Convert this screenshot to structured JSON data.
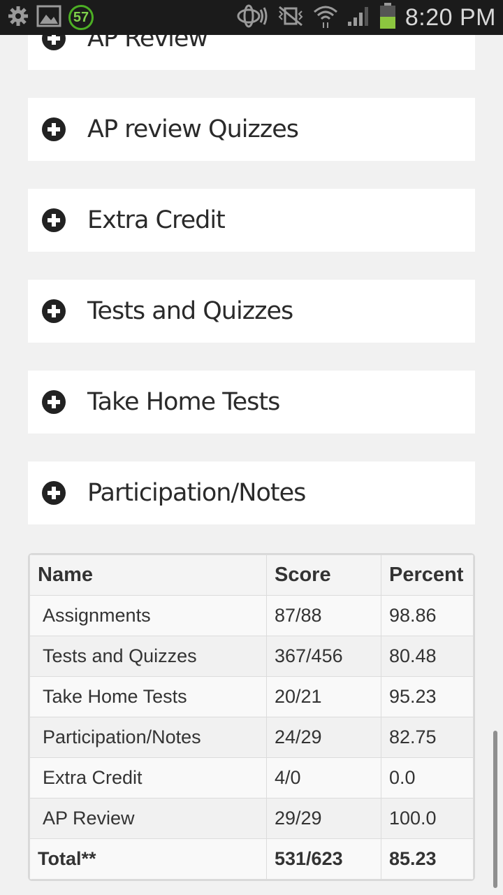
{
  "status_bar": {
    "notification_count": "57",
    "time": "8:20 PM",
    "colors": {
      "battery": "#8cc63f",
      "badge": "#4caf24"
    }
  },
  "sections": [
    {
      "label": "AP Review"
    },
    {
      "label": "AP review Quizzes"
    },
    {
      "label": "Extra Credit"
    },
    {
      "label": "Tests and Quizzes"
    },
    {
      "label": "Take Home Tests"
    },
    {
      "label": "Participation/Notes"
    }
  ],
  "grades": {
    "headers": {
      "name": "Name",
      "score": "Score",
      "percent": "Percent"
    },
    "rows": [
      {
        "name": "Assignments",
        "score": "87/88",
        "percent": "98.86"
      },
      {
        "name": "Tests and Quizzes",
        "score": "367/456",
        "percent": "80.48"
      },
      {
        "name": "Take Home Tests",
        "score": "20/21",
        "percent": "95.23"
      },
      {
        "name": "Participation/Notes",
        "score": "24/29",
        "percent": "82.75"
      },
      {
        "name": "Extra Credit",
        "score": "4/0",
        "percent": "0.0"
      },
      {
        "name": "AP Review",
        "score": "29/29",
        "percent": "100.0"
      }
    ],
    "total": {
      "name": "Total**",
      "score": "531/623",
      "percent": "85.23"
    }
  }
}
